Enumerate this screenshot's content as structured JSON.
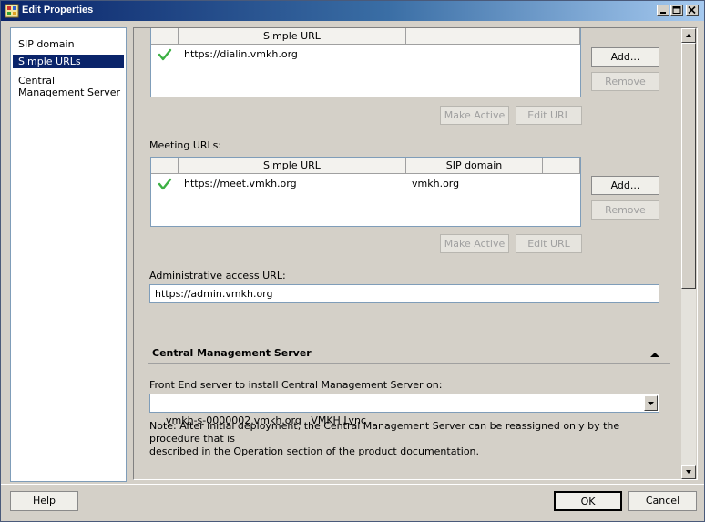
{
  "window": {
    "title": "Edit Properties",
    "icon": "properties-app-icon",
    "caption_buttons": [
      "minimize",
      "maximize",
      "close"
    ]
  },
  "nav": {
    "items": [
      {
        "label": "SIP domain",
        "selected": false
      },
      {
        "label": "Simple URLs",
        "selected": true
      },
      {
        "label": "Central Management Server",
        "selected": false
      }
    ]
  },
  "dialin": {
    "column_header": "Simple URL",
    "rows": [
      {
        "active": true,
        "url": "https://dialin.vmkh.org"
      }
    ],
    "add_label": "Add...",
    "remove_label": "Remove",
    "make_active_label": "Make Active",
    "edit_label": "Edit URL"
  },
  "meeting": {
    "label": "Meeting URLs:",
    "columns": [
      "Simple URL",
      "SIP domain"
    ],
    "rows": [
      {
        "active": true,
        "url": "https://meet.vmkh.org",
        "sip_domain": "vmkh.org"
      }
    ],
    "add_label": "Add...",
    "remove_label": "Remove",
    "make_active_label": "Make Active",
    "edit_label": "Edit URL"
  },
  "admin": {
    "label": "Administrative access URL:",
    "value": "https://admin.vmkh.org"
  },
  "cms": {
    "section_title": "Central Management Server",
    "frontend_label": "Front End server to install Central Management Server on:",
    "frontend_value": "vmkh-s-0000002.vmkh.org   VMKH Lync",
    "note_line1": "Note: After initial deployment, the Central Management Server can be reassigned only by the procedure that is",
    "note_line2": "described in the Operation section of the product documentation."
  },
  "footer": {
    "help_label": "Help",
    "ok_label": "OK",
    "cancel_label": "Cancel"
  },
  "colors": {
    "titlebar_start": "#0a246a",
    "titlebar_end": "#a6caf0",
    "selection": "#0a246a",
    "checkmark": "#3cb043",
    "dialog_bg": "#d4d0c8"
  }
}
